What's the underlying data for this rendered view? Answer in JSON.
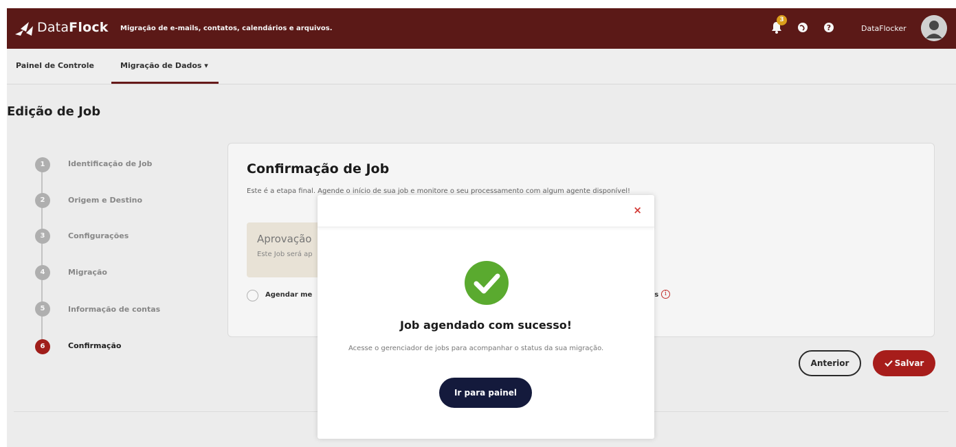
{
  "header": {
    "logo_light": "Data",
    "logo_bold": "Flock",
    "subtitle": "Migração de e-mails, contatos, calendários e arquivos.",
    "notifications_count": "3",
    "username": "DataFlocker",
    "accent_color": "#5e1a18"
  },
  "nav": {
    "items": [
      {
        "label": "Painel de Controle"
      },
      {
        "label": "Migração de Dados ▾"
      }
    ]
  },
  "page": {
    "title": "Edição de Job"
  },
  "steps": [
    {
      "number": "1",
      "label": "Identificação de Job"
    },
    {
      "number": "2",
      "label": "Origem e Destino"
    },
    {
      "number": "3",
      "label": "Configurações"
    },
    {
      "number": "4",
      "label": "Migração"
    },
    {
      "number": "5",
      "label": "Informação de contas"
    },
    {
      "number": "6",
      "label": "Confirmação"
    }
  ],
  "card": {
    "title": "Confirmação de Job",
    "description": "Este é a etapa final. Agende o início de sua job e monitore o seu processamento com algum agente disponível!",
    "approval_title": "Aprovação",
    "approval_text": "Este Job será ap",
    "radio_label": "Agendar me",
    "radio_label_right": "ois"
  },
  "buttons": {
    "previous": "Anterior",
    "save": "Salvar"
  },
  "modal": {
    "close": "×",
    "title": "Job agendado com sucesso!",
    "text": "Acesse o gerenciador de jobs para acompanhar o status da sua migração.",
    "button": "Ir para painel"
  }
}
